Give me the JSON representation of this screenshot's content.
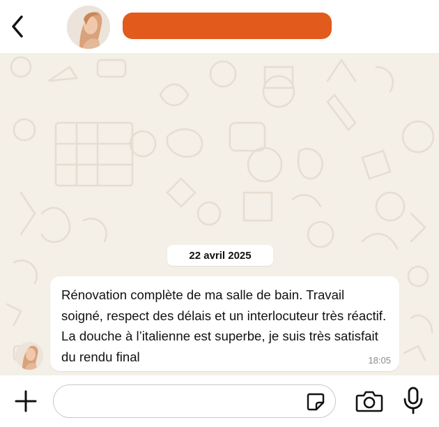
{
  "header": {
    "contact_name": ""
  },
  "chat": {
    "date_label": "22 avril 2025",
    "message": {
      "text": "Rénovation complète de ma salle de bain. Travail soigné, respect des délais et un interlocuteur très réactif. La douche à l’italienne est superbe, je suis très satisfait du rendu final",
      "time": "18:05"
    }
  },
  "composer": {
    "placeholder": ""
  },
  "colors": {
    "accent": "#e25a1c",
    "chat_background": "#f4efe7",
    "bubble": "#ffffff"
  },
  "icons": [
    "back-arrow-icon",
    "plus-icon",
    "sticker-icon",
    "camera-icon",
    "microphone-icon"
  ]
}
